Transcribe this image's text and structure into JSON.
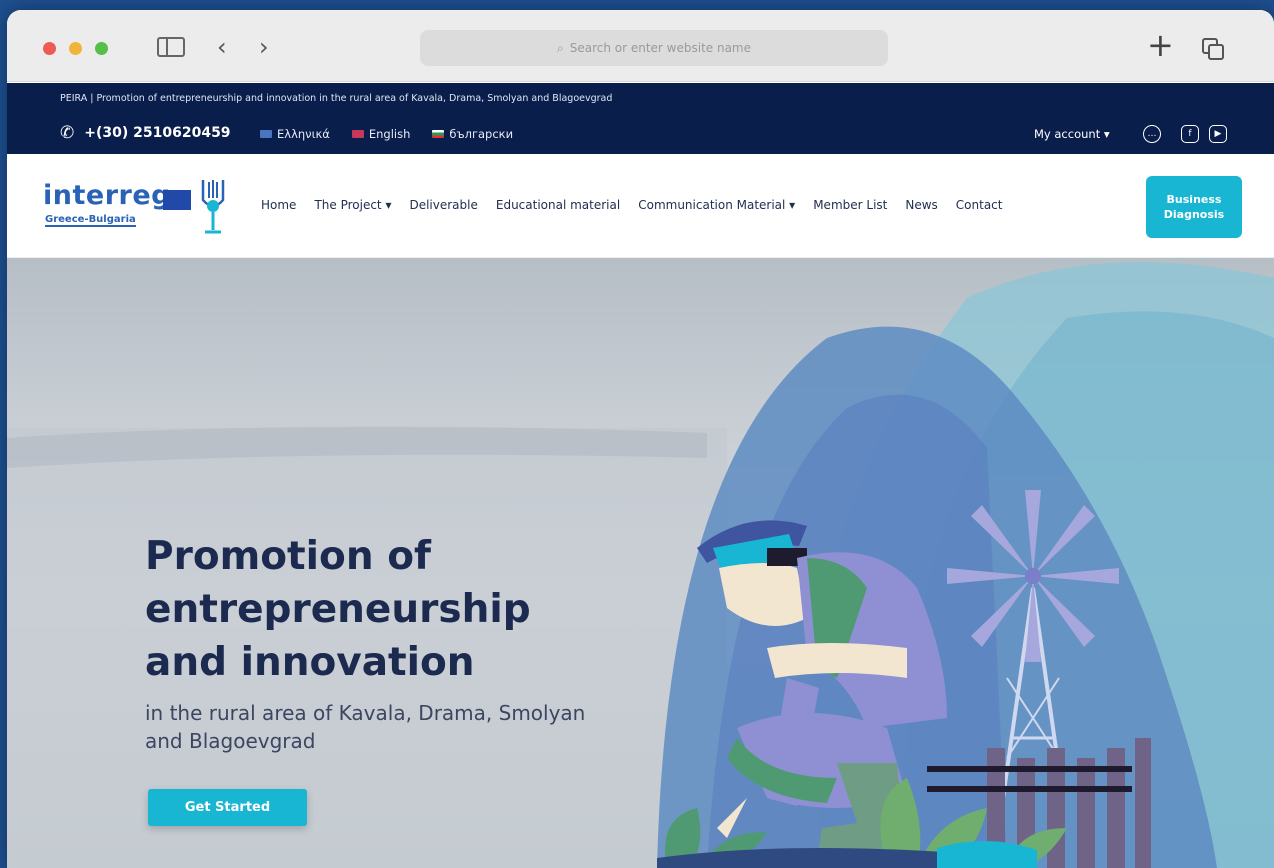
{
  "browser": {
    "address_placeholder": "Search or enter website name"
  },
  "topbar": {
    "title": "PEIRA | Promotion of entrepreneurship and innovation in the rural area of Kavala, Drama, Smolyan and Blagoevgrad",
    "phone": "+(30) 2510620459",
    "languages": [
      "Ελληνικά",
      "English",
      "български"
    ],
    "account": "My account ▾"
  },
  "logo": {
    "name": "interreg",
    "sub": "Greece-Bulgaria"
  },
  "nav": {
    "items": [
      "Home",
      "The Project ▾",
      "Deliverable",
      "Educational material",
      "Communication Material ▾",
      "Member List",
      "News",
      "Contact"
    ],
    "cta": "Business Diagnosis"
  },
  "hero": {
    "title": "Promotion of entrepreneurship and innovation",
    "subtitle": "in the rural area of Kavala, Drama, Smolyan and Blagoevgrad",
    "button": "Get Started"
  },
  "colors": {
    "navy": "#0a1e4c",
    "accent": "#18b6d2",
    "heading": "#1c2a50"
  }
}
